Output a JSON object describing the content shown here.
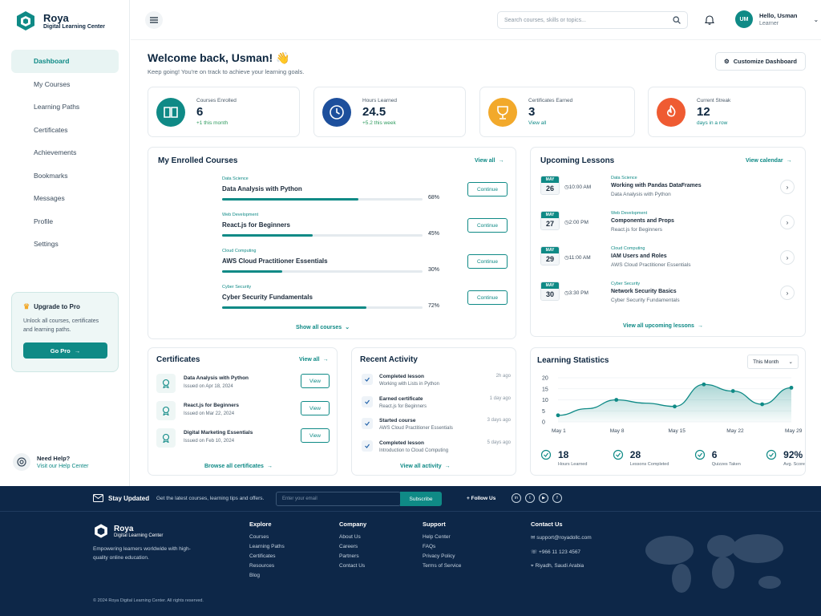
{
  "brand": {
    "name": "Roya",
    "subtitle": "Digital Learning Center"
  },
  "sidebar": {
    "items": [
      {
        "label": "Dashboard",
        "icon": "home-icon",
        "active": true
      },
      {
        "label": "My Courses",
        "icon": "book-icon"
      },
      {
        "label": "Learning Paths",
        "icon": "path-icon"
      },
      {
        "label": "Certificates",
        "icon": "certificate-icon"
      },
      {
        "label": "Achievements",
        "icon": "star-icon"
      },
      {
        "label": "Bookmarks",
        "icon": "bookmark-icon"
      },
      {
        "label": "Messages",
        "icon": "mail-icon"
      },
      {
        "label": "Profile",
        "icon": "user-icon"
      },
      {
        "label": "Settings",
        "icon": "gear-icon"
      }
    ],
    "upgrade": {
      "title": "Upgrade to Pro",
      "text": "Unlock all courses, certificates and learning paths.",
      "button": "Go Pro"
    },
    "help": {
      "title": "Need Help?",
      "link": "Visit our Help Center"
    }
  },
  "topbar": {
    "search_placeholder": "Search courses, skills or topics...",
    "user_greeting": "Hello, Usman",
    "user_role": "Learner",
    "avatar_initials": "UM"
  },
  "welcome": {
    "title": "Welcome back, Usman! 👋",
    "subtitle": "Keep going! You're on track to achieve your learning goals.",
    "customize": "Customize Dashboard"
  },
  "stats": [
    {
      "label": "Courses Enrolled",
      "value": "6",
      "sub": "+1 this month",
      "color": "#0f8a86"
    },
    {
      "label": "Hours Learned",
      "value": "24.5",
      "sub": "+5.2 this week",
      "color": "#1d4f9c"
    },
    {
      "label": "Certificates Earned",
      "value": "3",
      "sub": "View all",
      "color": "#f2a92b"
    },
    {
      "label": "Current Streak",
      "value": "12",
      "sub": "days in a row",
      "color": "#ef5b32"
    }
  ],
  "enrolled": {
    "title": "My Enrolled Courses",
    "view_all": "View all",
    "show_all": "Show all courses",
    "courses": [
      {
        "category": "Data Science",
        "title": "Data Analysis with Python",
        "progress": 68,
        "progress_label": "68%",
        "button": "Continue"
      },
      {
        "category": "Web Development",
        "title": "React.js for Beginners",
        "progress": 45,
        "progress_label": "45%",
        "button": "Continue"
      },
      {
        "category": "Cloud Computing",
        "title": "AWS Cloud Practitioner Essentials",
        "progress": 30,
        "progress_label": "30%",
        "button": "Continue"
      },
      {
        "category": "Cyber Security",
        "title": "Cyber Security Fundamentals",
        "progress": 72,
        "progress_label": "72%",
        "button": "Continue"
      }
    ]
  },
  "lessons": {
    "title": "Upcoming Lessons",
    "view_calendar": "View calendar",
    "view_all": "View all upcoming lessons",
    "items": [
      {
        "month": "MAY",
        "day": "26",
        "time": "10:00 AM",
        "category": "Data Science",
        "title": "Working with Pandas DataFrames",
        "course": "Data Analysis with Python"
      },
      {
        "month": "MAY",
        "day": "27",
        "time": "2:00 PM",
        "category": "Web Development",
        "title": "Components and Props",
        "course": "React.js for Beginners"
      },
      {
        "month": "MAY",
        "day": "29",
        "time": "11:00 AM",
        "category": "Cloud Computing",
        "title": "IAM Users and Roles",
        "course": "AWS Cloud Practitioner Essentials"
      },
      {
        "month": "MAY",
        "day": "30",
        "time": "3:30 PM",
        "category": "Cyber Security",
        "title": "Network Security Basics",
        "course": "Cyber Security Fundamentals"
      }
    ]
  },
  "certificates": {
    "title": "Certificates",
    "view_all": "View all",
    "browse": "Browse all certificates",
    "items": [
      {
        "title": "Data Analysis with Python",
        "issued": "Issued on Apr 18, 2024",
        "button": "View"
      },
      {
        "title": "React.js for Beginners",
        "issued": "Issued on Mar 22, 2024",
        "button": "View"
      },
      {
        "title": "Digital Marketing Essentials",
        "issued": "Issued on Feb 10, 2024",
        "button": "View"
      }
    ]
  },
  "activity": {
    "title": "Recent Activity",
    "view_all": "View all activity",
    "items": [
      {
        "title": "Completed lesson",
        "detail": "Working with Lists in Python",
        "time": "2h ago"
      },
      {
        "title": "Earned certificate",
        "detail": "React.js for Beginners",
        "time": "1 day ago"
      },
      {
        "title": "Started course",
        "detail": "AWS Cloud Practitioner Essentials",
        "time": "3 days ago"
      },
      {
        "title": "Completed lesson",
        "detail": "Introduction to Cloud Computing",
        "time": "5 days ago"
      }
    ]
  },
  "stats_panel": {
    "title": "Learning Statistics",
    "period": "This Month",
    "minis": [
      {
        "value": "18",
        "label": "Hours Learned"
      },
      {
        "value": "28",
        "label": "Lessons Completed"
      },
      {
        "value": "6",
        "label": "Quizzes Taken"
      },
      {
        "value": "92%",
        "label": "Avg. Score"
      }
    ]
  },
  "chart_data": {
    "type": "area",
    "x": [
      "May 1",
      "May 5",
      "May 8",
      "May 12",
      "May 15",
      "May 19",
      "May 22",
      "May 26",
      "May 29"
    ],
    "values": [
      3,
      6,
      10,
      8.5,
      7,
      17,
      14,
      8,
      15.5
    ],
    "categories_labels": [
      "May 1",
      "May 8",
      "May 15",
      "May 22",
      "May 29"
    ],
    "yticks": [
      "0",
      "5",
      "10",
      "15",
      "20"
    ],
    "ylim": [
      0,
      20
    ],
    "color": "#0f8a86"
  },
  "footer": {
    "stay_updated": "Stay Updated",
    "stay_text": "Get the latest courses, learning tips and offers.",
    "email_placeholder": "Enter your email",
    "subscribe": "Subscribe",
    "follow": "Follow Us",
    "tagline": "Empowering learners worldwide with high-quality online education.",
    "columns": [
      {
        "title": "Explore",
        "links": [
          "Courses",
          "Learning Paths",
          "Certificates",
          "Resources",
          "Blog"
        ]
      },
      {
        "title": "Company",
        "links": [
          "About Us",
          "Careers",
          "Partners",
          "Contact Us"
        ]
      },
      {
        "title": "Support",
        "links": [
          "Help Center",
          "FAQs",
          "Privacy Policy",
          "Terms of Service"
        ]
      }
    ],
    "contact": {
      "title": "Contact Us",
      "email": "support@royadollc.com",
      "phone": "+966 11 123 4567",
      "address": "Riyadh, Saudi Arabia"
    },
    "copyright": "© 2024 Roya Digital Learning Center. All rights reserved."
  }
}
